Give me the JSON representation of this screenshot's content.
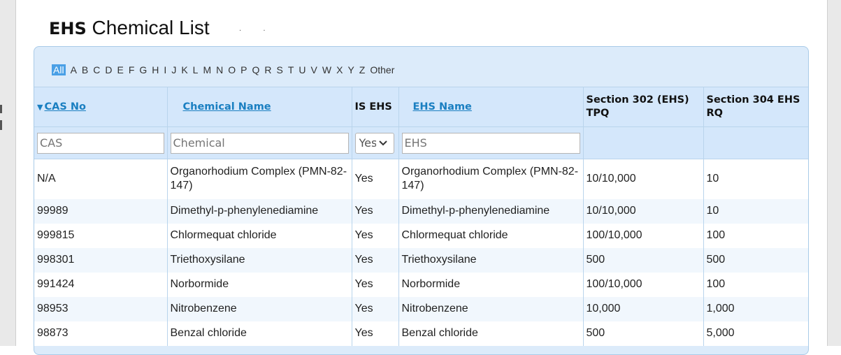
{
  "page": {
    "title_bold": "EHS",
    "title_rest": " Chemical List",
    "dots": ". ."
  },
  "alphabet": [
    "All",
    "A",
    "B",
    "C",
    "D",
    "E",
    "F",
    "G",
    "H",
    "I",
    "J",
    "K",
    "L",
    "M",
    "N",
    "O",
    "P",
    "Q",
    "R",
    "S",
    "T",
    "U",
    "V",
    "W",
    "X",
    "Y",
    "Z",
    "Other"
  ],
  "alphabet_active": "All",
  "columns": {
    "cas_no": "CAS No",
    "chemical_name": "Chemical Name",
    "is_ehs": "IS EHS",
    "ehs_name": "EHS Name",
    "tpq": "Section 302 (EHS) TPQ",
    "rq": "Section 304 EHS RQ"
  },
  "sort": {
    "column": "CAS No",
    "icon": "sort-desc-triangle-icon"
  },
  "filters": {
    "cas_placeholder": "CAS",
    "chemical_placeholder": "Chemical",
    "is_ehs_value": "Yes",
    "ehs_placeholder": "EHS"
  },
  "rows": [
    {
      "cas": "N/A",
      "chemical": "Organorhodium Complex (PMN-82-147)",
      "is_ehs": "Yes",
      "ehs_name": "Organorhodium Complex (PMN-82-147)",
      "tpq": "10/10,000",
      "rq": "10"
    },
    {
      "cas": "99989",
      "chemical": "Dimethyl-p-phenylenediamine",
      "is_ehs": "Yes",
      "ehs_name": "Dimethyl-p-phenylenediamine",
      "tpq": "10/10,000",
      "rq": "10"
    },
    {
      "cas": "999815",
      "chemical": "Chlormequat chloride",
      "is_ehs": "Yes",
      "ehs_name": "Chlormequat chloride",
      "tpq": "100/10,000",
      "rq": "100"
    },
    {
      "cas": "998301",
      "chemical": "Triethoxysilane",
      "is_ehs": "Yes",
      "ehs_name": "Triethoxysilane",
      "tpq": "500",
      "rq": "500"
    },
    {
      "cas": "991424",
      "chemical": "Norbormide",
      "is_ehs": "Yes",
      "ehs_name": "Norbormide",
      "tpq": "100/10,000",
      "rq": "100"
    },
    {
      "cas": "98953",
      "chemical": "Nitrobenzene",
      "is_ehs": "Yes",
      "ehs_name": "Nitrobenzene",
      "tpq": "10,000",
      "rq": "1,000"
    },
    {
      "cas": "98873",
      "chemical": "Benzal chloride",
      "is_ehs": "Yes",
      "ehs_name": "Benzal chloride",
      "tpq": "500",
      "rq": "5,000"
    }
  ],
  "colors": {
    "link": "#1a7fc1",
    "header_bg": "#d4e7fb",
    "active_letter_bg": "#4aa0e6",
    "alt_row_bg": "#f1f7fd"
  }
}
